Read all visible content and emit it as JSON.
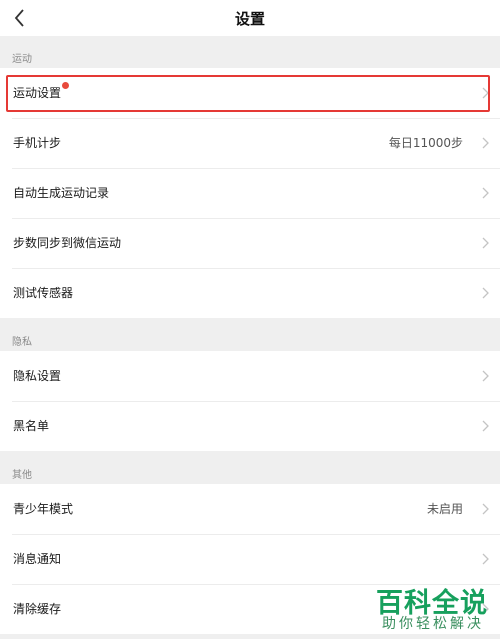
{
  "header": {
    "title": "设置"
  },
  "sections": {
    "sport": "运动",
    "privacy": "隐私",
    "other": "其他"
  },
  "sport_items": [
    {
      "label": "运动设置"
    },
    {
      "label": "手机计步",
      "value": "每日11000步"
    },
    {
      "label": "自动生成运动记录"
    },
    {
      "label": "步数同步到微信运动"
    },
    {
      "label": "测试传感器"
    }
  ],
  "privacy_items": [
    {
      "label": "隐私设置"
    },
    {
      "label": "黑名单"
    }
  ],
  "other_items": [
    {
      "label": "青少年模式",
      "value": "未启用"
    },
    {
      "label": "消息通知"
    },
    {
      "label": "清除缓存"
    }
  ],
  "watermark": {
    "title": "百科全说",
    "subtitle": "助你轻松解决"
  },
  "colors": {
    "highlight": "#e53935",
    "badge": "#e84a3c",
    "watermark": "#17a05d"
  }
}
